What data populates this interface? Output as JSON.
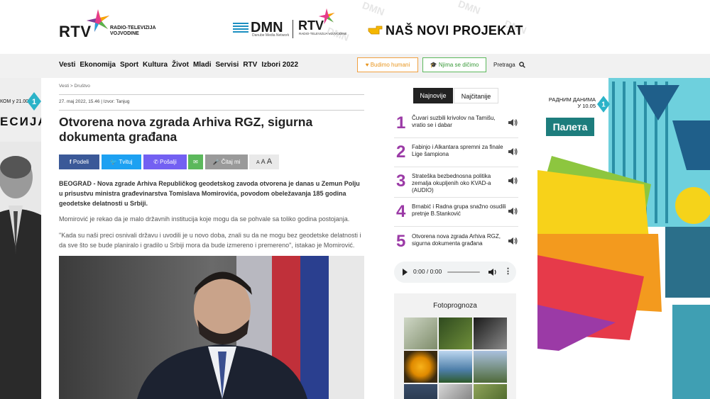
{
  "header": {
    "logo_text": "RTV",
    "logo_sub": "RADIO-TELEVIZIJA VOJVODINE",
    "banner": {
      "dmn_text": "DMN",
      "dmn_sub": "Danube Media Network",
      "rtv_text": "RTV",
      "rtv_sub": "RADIO-TELEVIZIJA VOJVODINE",
      "watermark": "DMN",
      "slogan": "NAŠ NOVI PROJEKAT"
    }
  },
  "nav": {
    "items": [
      "Vesti",
      "Ekonomija",
      "Sport",
      "Kultura",
      "Život",
      "Mladi",
      "Servisi",
      "RTV",
      "Izbori 2022"
    ],
    "budimo_humani": "Budimo humani",
    "nijma_se_dicimo": "Njima se dičimo",
    "pretraga": "Pretraga"
  },
  "left_ad": {
    "kom": "КОМ у 21.00",
    "esija": "ЕСИЈА"
  },
  "article": {
    "breadcrumb": "Vesti > Društvo",
    "meta": "27. maj 2022, 15.46 | Izvor: Tanjug",
    "title": "Otvorena nova zgrada Arhiva RGZ, sigurna dokumenta građana",
    "share": {
      "podeli": "Podeli",
      "tvituj": "Tvituj",
      "posalji": "Pošalji",
      "citaj": "Čitaj mi"
    },
    "font_sizes": [
      "A",
      "A",
      "A"
    ],
    "lead": "BEOGRAD - Nova zgrade Arhiva Republičkog geodetskog zavoda otvorena je danas u Zemun Polju u prisustvu ministra građevinarstva Tomislava Momirovića, povodom obeležavanja 185 godina geodetske delatnosti u Srbiji.",
    "p1": "Momirović je rekao da je malo državnih institucija koje mogu da se pohvale sa toliko godina postojanja.",
    "p2": "\"Kada su naši preci osnivali državu i uvodili je u novo doba, znali su da ne mogu bez geodetske delatnosti i da sve što se bude planiralo i gradilo u Srbiji mora da bude izmereno i premereno\", istakao je Momirović."
  },
  "sidebar": {
    "tab_najnovije": "Najnovije",
    "tab_najcitanije": "Najčitanije",
    "news": [
      {
        "num": "1",
        "text": "Čuvari suzbili krivolov na Tamišu, vratio se i dabar"
      },
      {
        "num": "2",
        "text": "Fabinjo i Alkantara spremni za finale Lige šampiona"
      },
      {
        "num": "3",
        "text": "Strateška bezbednosna politika zemalja okupljenih oko KVAD-a (AUDIO)"
      },
      {
        "num": "4",
        "text": "Brnabić i Radna grupa snažno osudili pretnje B.Stanković"
      },
      {
        "num": "5",
        "text": "Otvorena nova zgrada Arhiva RGZ, sigurna dokumenta građana"
      }
    ],
    "audio_time": "0:00 / 0:00",
    "fotoprognoza": "Fotoprognoza"
  },
  "right_ad": {
    "radnim": "РАДНИМ ДАНИМА У 10.05",
    "paleta": "Палета"
  },
  "colors": {
    "facebook": "#3b5998",
    "twitter": "#1da1f2",
    "viber": "#7360f2",
    "email": "#5cb85c",
    "citaj": "#9a9a9a",
    "accent_purple": "#9b3aa6",
    "humani": "#e8951e",
    "nijma": "#3a9a3a"
  }
}
